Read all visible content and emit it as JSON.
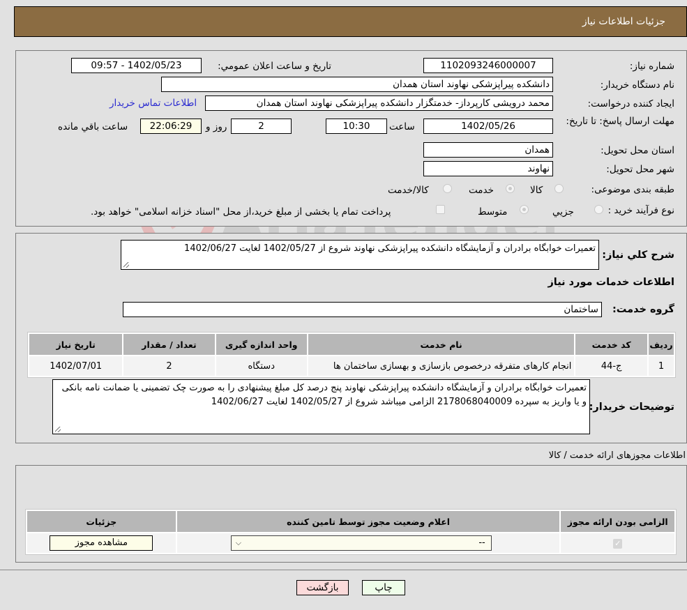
{
  "header": {
    "title": "جزئیات اطلاعات نیاز"
  },
  "form": {
    "need_number_label": "شماره نیاز:",
    "need_number": "1102093246000007",
    "announce_label": "تاریخ و ساعت اعلان عمومي:",
    "announce_value": "1402/05/23 - 09:57",
    "buyer_org_label": "نام دستگاه خريدار:",
    "buyer_org": "دانشکده پیراپزشکی نهاوند  استان همدان",
    "creator_label": "ايجاد کننده درخواست:",
    "creator": "محمد درویشی کارپرداز- خدمتگزار دانشکده پیراپزشکی نهاوند  استان همدان",
    "contact_link": "اطلاعات تماس خريدار",
    "deadline_label": "مهلت ارسال پاسخ: تا تاریخ:",
    "deadline_date": "1402/05/26",
    "time_label": "ساعت",
    "deadline_time": "10:30",
    "days_value": "2",
    "days_label": "روز و",
    "remaining_time": "22:06:29",
    "remaining_label": "ساعت باقي مانده",
    "province_label": "استان محل تحويل:",
    "province": "همدان",
    "city_label": "شهر محل تحويل:",
    "city": "نهاوند",
    "category_label": "طبقه بندی موضوعی:",
    "category_options": [
      "کالا",
      "خدمت",
      "کالا/خدمت"
    ],
    "category_selected": "خدمت",
    "process_label": "نوع فرآيند خريد :",
    "process_options": [
      "جزيي",
      "متوسط"
    ],
    "process_selected": "متوسط",
    "treasury_note": "پرداخت تمام يا بخشی از مبلغ خريد،از محل \"اسناد خزانه اسلامی\" خواهد بود."
  },
  "description": {
    "label": "شرح كلي نياز:",
    "value": "تعمیرات خوابگاه برادران و آزمایشگاه دانشکده پیراپزشکی نهاوند شروع از 1402/05/27 لغایت 1402/06/27"
  },
  "services": {
    "section_title": "اطلاعات خدمات مورد نیاز",
    "group_label": "گروه خدمت:",
    "group_value": "ساختمان",
    "columns": [
      "ردیف",
      "کد خدمت",
      "نام خدمت",
      "واحد اندازه گیری",
      "تعداد / مقدار",
      "تاریخ نیاز"
    ],
    "rows": [
      [
        "1",
        "ج-44",
        "انجام کارهای متفرقه درخصوص بازسازی و بهسازی ساختمان ها",
        "دستگاه",
        "2",
        "1402/07/01"
      ]
    ]
  },
  "buyer_notes": {
    "label": "توضيحات خريدار:",
    "value": "تعمیرات خوابگاه برادران و آزمایشگاه دانشکده پیراپزشکی نهاوند پنج درصد کل مبلغ پیشنهادی را به صورت چک تضمینی یا ضمانت نامه بانکی و یا واریز به سپرده 2178068040009 الزامی میباشد شروع از 1402/05/27 لغایت 1402/06/27"
  },
  "permits": {
    "section_title": "اطلاعات مجوزهای ارائه خدمت / کالا",
    "columns": [
      "الزامی بودن ارائه مجوز",
      "اعلام وضعیت مجوز توسط تامین کننده",
      "جزئیات"
    ],
    "row": {
      "required_checked": true,
      "status_selected": "--",
      "details_button": "مشاهده مجوز"
    }
  },
  "actions": {
    "print": "چاپ",
    "back": "بازگشت"
  },
  "watermark": {
    "text": "AriaTender.neT"
  },
  "colors": {
    "header_bg": "#8b6c42",
    "link": "#2a2ad0",
    "back_button_bg": "#fbdada",
    "print_button_bg": "#eefde9"
  }
}
